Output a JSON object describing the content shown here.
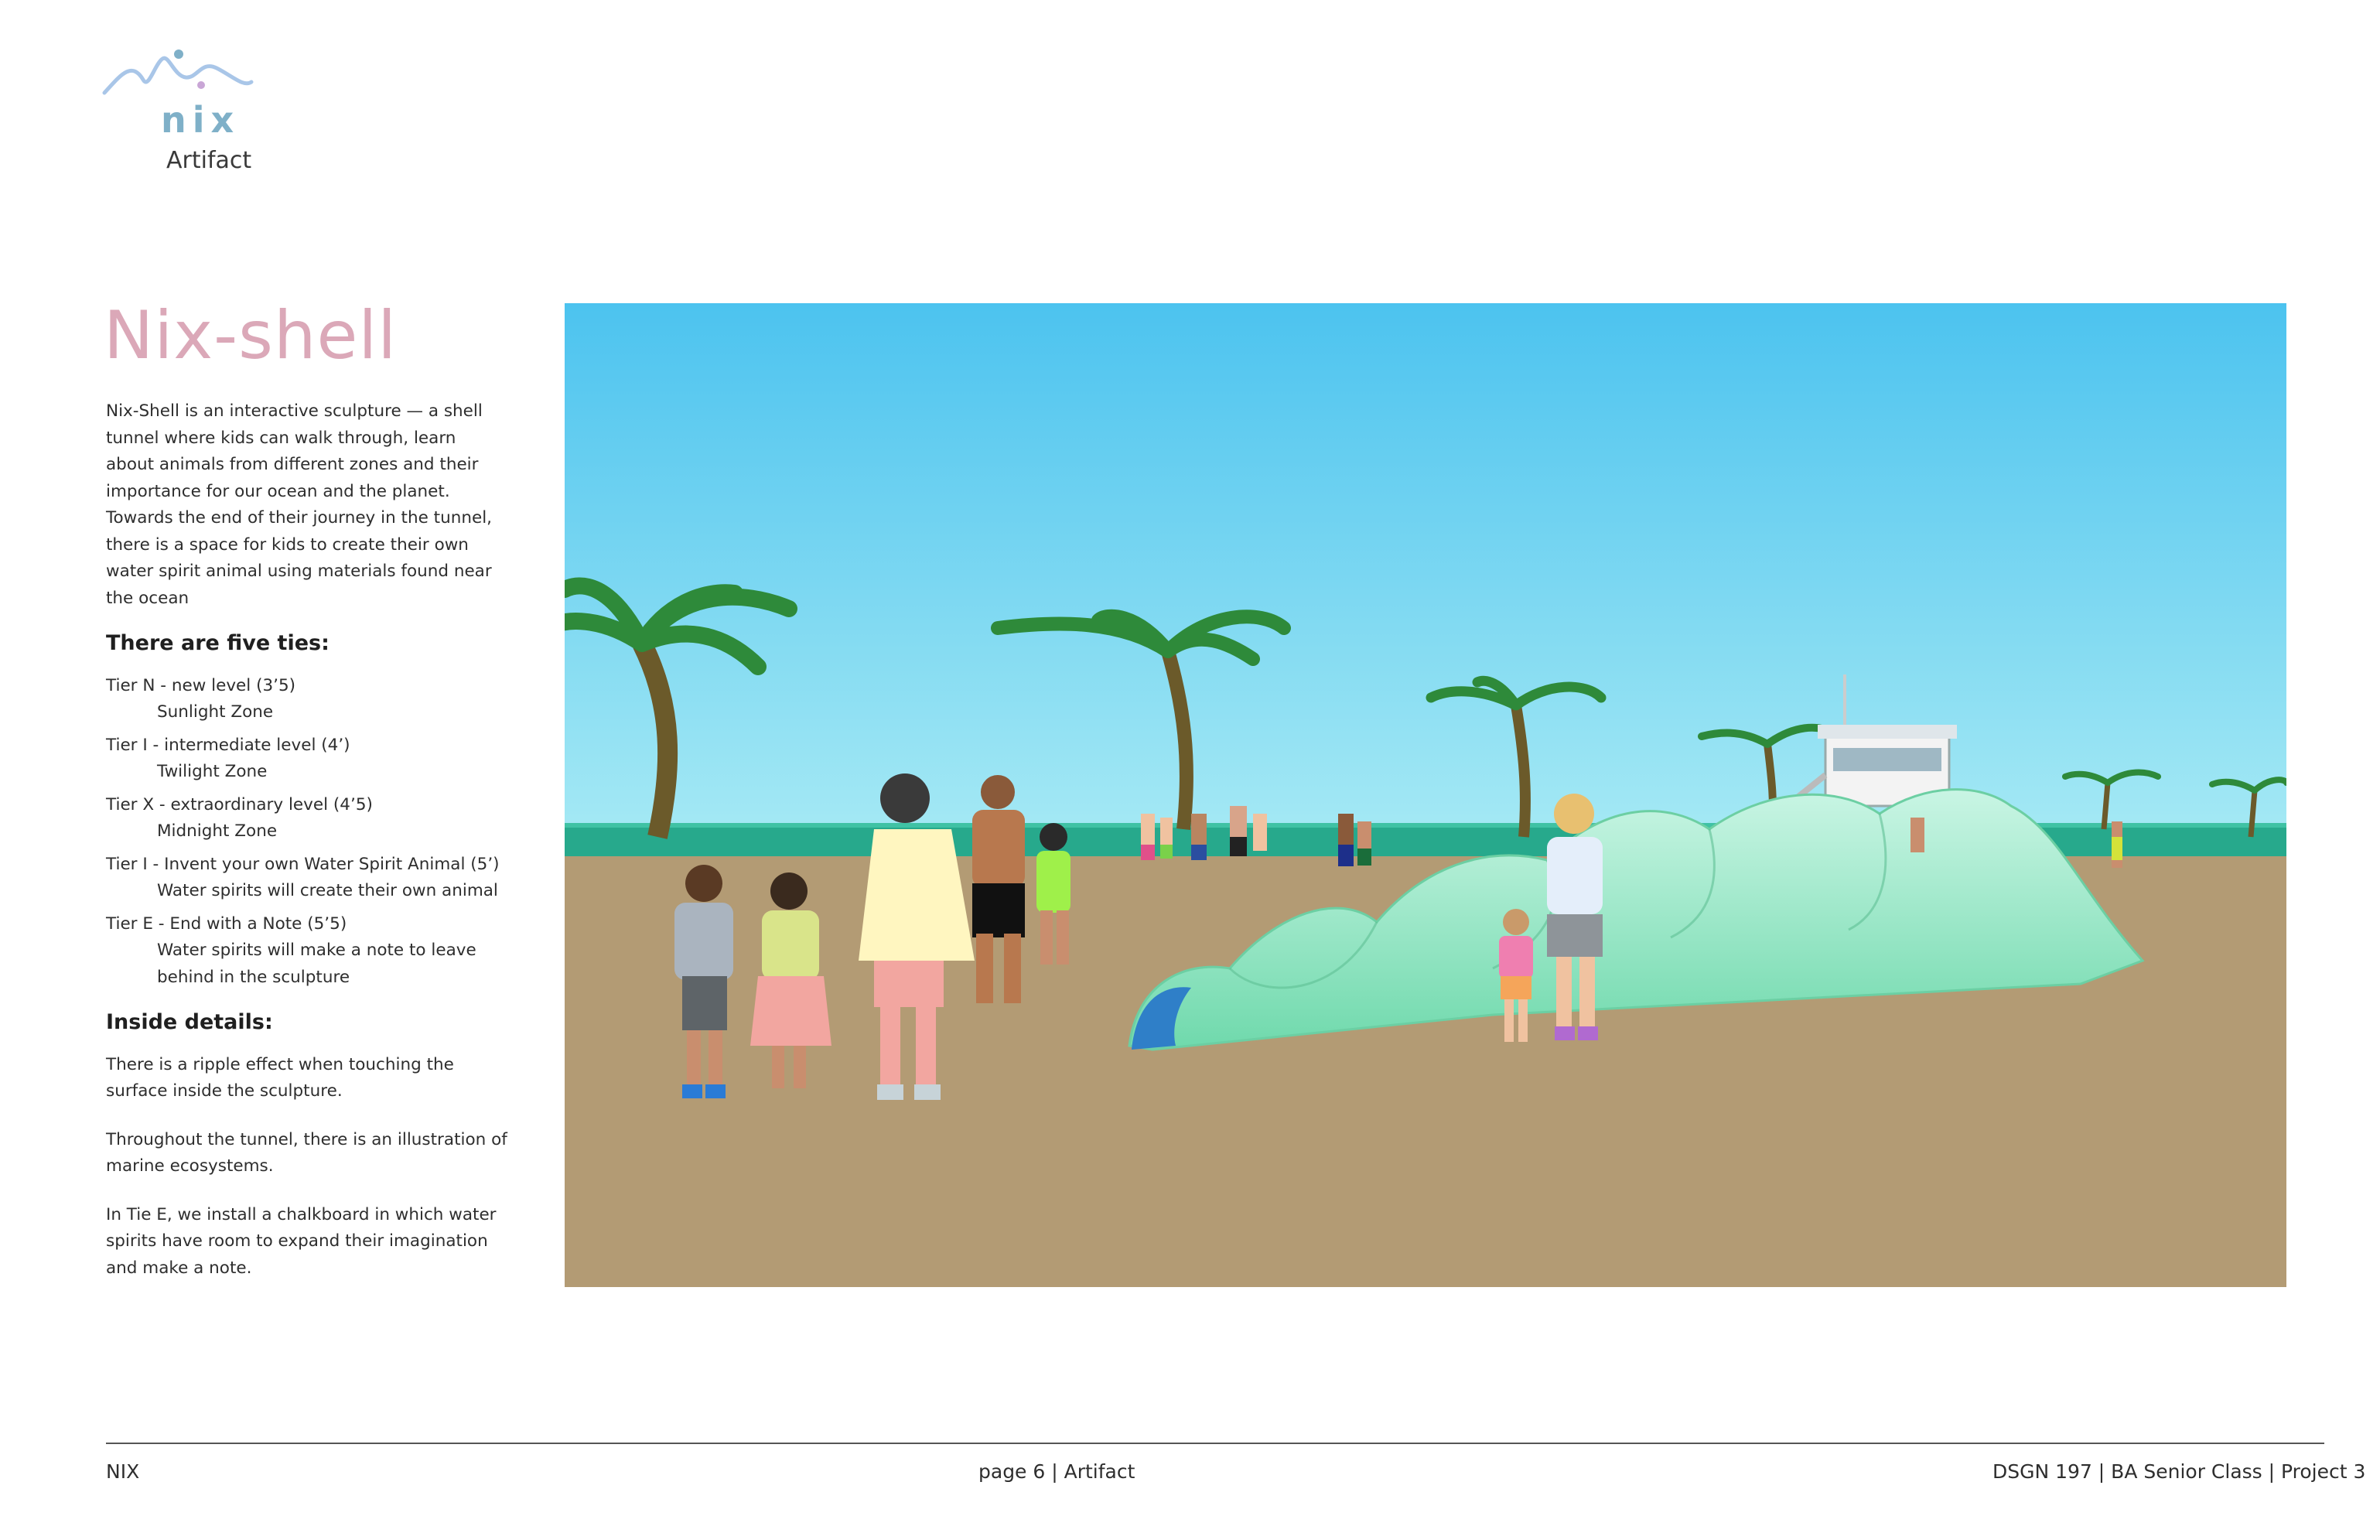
{
  "brand": {
    "logo_word": "nix",
    "section": "Artifact"
  },
  "title": "Nix-shell",
  "intro": "Nix-Shell is an interactive sculpture — a shell tunnel where kids can walk through, learn about animals from different zones and their importance for our ocean and the planet. Towards the end of their journey in the tunnel, there is a space for kids to create their own water spirit animal using materials found near the ocean",
  "tiers_heading": "There are five ties:",
  "tiers": [
    {
      "line": "Tier N - new level (3’5)",
      "sub": "Sunlight Zone"
    },
    {
      "line": "Tier I - intermediate level (4’)",
      "sub": "Twilight Zone"
    },
    {
      "line": "Tier X - extraordinary level (4’5)",
      "sub": "Midnight Zone"
    },
    {
      "line": "Tier I - Invent your own Water Spirit Animal (5’)",
      "sub": "Water spirits will create their own animal"
    },
    {
      "line": "Tier E  - End with a Note (5’5)",
      "sub": "Water spirits will make a note to leave behind in the sculpture"
    }
  ],
  "inside_heading": "Inside details:",
  "inside_details": [
    "There is a ripple effect when touching the surface inside the sculpture.",
    "Throughout the tunnel, there is an illustration of marine ecosystems.",
    "In Tie E, we install a chalkboard in which water spirits have room to expand their imagination and make a note."
  ],
  "footer": {
    "left": "NIX",
    "center": "page 6  | Artifact",
    "right": "DSGN 197 | BA Senior Class | Project 3"
  },
  "colors": {
    "title": "#dba8b8",
    "logo": "#7fb0c8",
    "sky_top": "#4cc3ef",
    "sky_bottom": "#9fe6f4",
    "ocean": "#27a98c",
    "sand": "#b39b74",
    "sculpture": "#7fe0b4"
  }
}
